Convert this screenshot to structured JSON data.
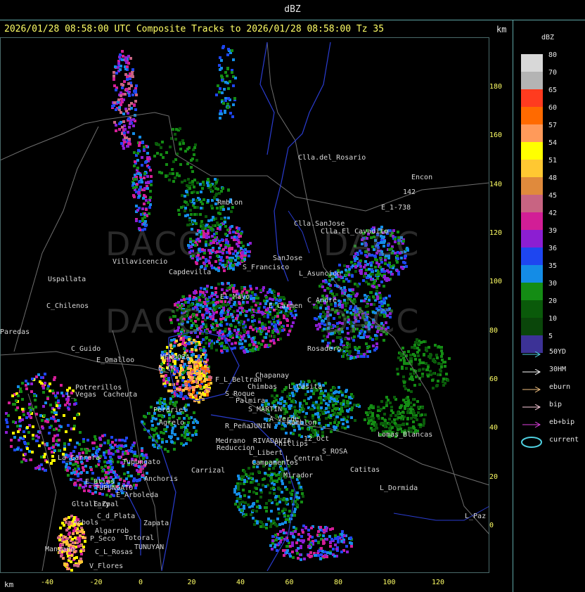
{
  "header": {
    "title": "dBZ"
  },
  "subtitle": "2026/01/28 08:58:00 UTC Composite Tracks to 2026/01/28 08:58:00 Tz 35",
  "axes": {
    "unit_top": "km",
    "unit_bottom": "km",
    "y_ticks": [
      "180",
      "160",
      "140",
      "120",
      "100",
      "80",
      "60",
      "40",
      "20",
      "0"
    ],
    "x_ticks": [
      "-40",
      "-20",
      "0",
      "20",
      "40",
      "60",
      "80",
      "100",
      "120"
    ]
  },
  "legend": {
    "title": "dBZ",
    "entries": [
      {
        "label": "80",
        "color": "#d8d8d8"
      },
      {
        "label": "70",
        "color": "#b4b4b4"
      },
      {
        "label": "65",
        "color": "#ff3b1f"
      },
      {
        "label": "60",
        "color": "#ff6a00"
      },
      {
        "label": "57",
        "color": "#ff9a5a"
      },
      {
        "label": "54",
        "color": "#ffff00"
      },
      {
        "label": "51",
        "color": "#ffc832"
      },
      {
        "label": "48",
        "color": "#e08a3c"
      },
      {
        "label": "45",
        "color": "#c86482"
      },
      {
        "label": "42",
        "color": "#d21e96"
      },
      {
        "label": "39",
        "color": "#8c1ed2"
      },
      {
        "label": "36",
        "color": "#1e46f0"
      },
      {
        "label": "35",
        "color": "#148ce6"
      },
      {
        "label": "30",
        "color": "#148c14"
      },
      {
        "label": "20",
        "color": "#0a5a0a"
      },
      {
        "label": "10",
        "color": "#0a460a"
      },
      {
        "label": "5",
        "color": "#3c3296"
      }
    ]
  },
  "tracks": [
    {
      "label": "50YD",
      "color": "#4fd0e0"
    },
    {
      "label": "30HM",
      "color": "#ffffff"
    },
    {
      "label": "eburn",
      "color": "#f0c080"
    },
    {
      "label": "bip",
      "color": "#ffd0e0"
    },
    {
      "label": "eb+bip",
      "color": "#e040e0"
    },
    {
      "label": "current",
      "color": "#4fd0e0"
    }
  ],
  "places": [
    {
      "name": "Clla.del_Rosario"
    },
    {
      "name": "Encon"
    },
    {
      "name": "142"
    },
    {
      "name": "E_1-738"
    },
    {
      "name": "Rmblon"
    },
    {
      "name": "Clla.SanJose"
    },
    {
      "name": "Clla.El_Cavadito"
    },
    {
      "name": "Villavicencio"
    },
    {
      "name": "Capdevilla"
    },
    {
      "name": "S_Francisco"
    },
    {
      "name": "SanJose"
    },
    {
      "name": "L_Asuncion"
    },
    {
      "name": "Uspallata"
    },
    {
      "name": "C_Chilenos"
    },
    {
      "name": "Paredas"
    },
    {
      "name": "El_Mayo"
    },
    {
      "name": "E_Carmen"
    },
    {
      "name": "C_Andre"
    },
    {
      "name": "C_Guido"
    },
    {
      "name": "E_Omalloo"
    },
    {
      "name": "MENDOZA"
    },
    {
      "name": "G_CR"
    },
    {
      "name": "Rosadero"
    },
    {
      "name": "Chapanay"
    },
    {
      "name": "Potrerillos"
    },
    {
      "name": "L_Vegas"
    },
    {
      "name": "Cacheuta"
    },
    {
      "name": "F_L_Beltran"
    },
    {
      "name": "Chimbas"
    },
    {
      "name": "L_Casita"
    },
    {
      "name": "S_Roque"
    },
    {
      "name": "Palmira"
    },
    {
      "name": "S_MARTIN"
    },
    {
      "name": "Perdriel"
    },
    {
      "name": "Agrelo"
    },
    {
      "name": "A_Verde"
    },
    {
      "name": "Ramblon"
    },
    {
      "name": "R_Peña"
    },
    {
      "name": "JUNIN"
    },
    {
      "name": "Lomas_Blancas"
    },
    {
      "name": "Medrano"
    },
    {
      "name": "RIVADAVIA"
    },
    {
      "name": "Phillips"
    },
    {
      "name": "12_Oct"
    },
    {
      "name": "Reduccion"
    },
    {
      "name": "L_Libert"
    },
    {
      "name": "S_ROSA"
    },
    {
      "name": "Campamentos"
    },
    {
      "name": "L_Central"
    },
    {
      "name": "La_Carrera"
    },
    {
      "name": "Tupungato"
    },
    {
      "name": "E_Btias"
    },
    {
      "name": "Anchoris"
    },
    {
      "name": "Carrizal"
    },
    {
      "name": "Catitas"
    },
    {
      "name": "Mirador"
    },
    {
      "name": "L_Dormida"
    },
    {
      "name": "TUPUNGATO"
    },
    {
      "name": "E_Arboleda"
    },
    {
      "name": "Gltallary"
    },
    {
      "name": "E_Zpal"
    },
    {
      "name": "C_d_Plata"
    },
    {
      "name": "Arbols"
    },
    {
      "name": "Algarrob"
    },
    {
      "name": "Zapata"
    },
    {
      "name": "L_Paz"
    },
    {
      "name": "P_Seco"
    },
    {
      "name": "Totoral"
    },
    {
      "name": "TUNUYAN"
    },
    {
      "name": "Manzano"
    },
    {
      "name": "C_L_Rosas"
    },
    {
      "name": "V_Flores"
    }
  ],
  "watermark": "DACC"
}
